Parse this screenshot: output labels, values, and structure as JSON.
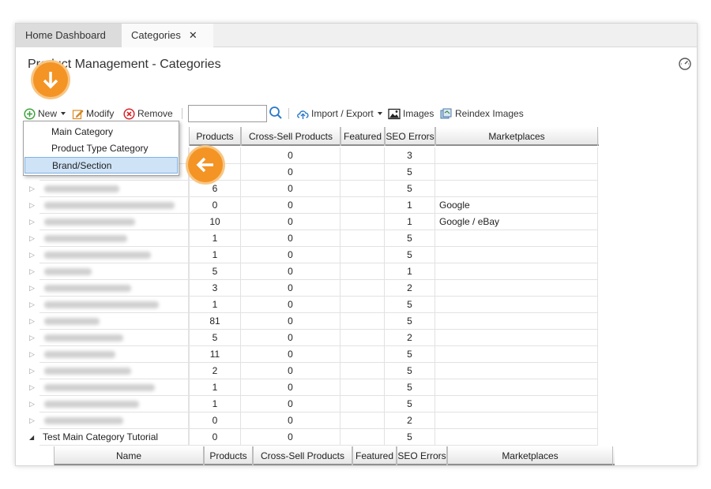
{
  "tabs": {
    "home": "Home Dashboard",
    "categories": "Categories",
    "close_glyph": "✕"
  },
  "page": {
    "title": "Product Management - Categories"
  },
  "toolbar": {
    "new_label": "New",
    "modify_label": "Modify",
    "remove_label": "Remove",
    "search_value": "",
    "import_export_label": "Import / Export",
    "images_label": "Images",
    "reindex_label": "Reindex Images"
  },
  "new_menu": {
    "items": [
      "Main Category",
      "Product Type Category",
      "Brand/Section"
    ],
    "selected": "Brand/Section"
  },
  "grid": {
    "columns": {
      "products": "Products",
      "cross_sell": "Cross-Sell Products",
      "featured": "Featured",
      "seo_errors": "SEO Errors",
      "marketplaces": "Marketplaces"
    },
    "rows": [
      {
        "products": "",
        "cross_sell": "0",
        "featured": "",
        "seo": "3",
        "marketplaces": ""
      },
      {
        "products": "",
        "cross_sell": "0",
        "featured": "",
        "seo": "5",
        "marketplaces": ""
      },
      {
        "products": "6",
        "cross_sell": "0",
        "featured": "",
        "seo": "5",
        "marketplaces": ""
      },
      {
        "products": "0",
        "cross_sell": "0",
        "featured": "",
        "seo": "1",
        "marketplaces": "Google"
      },
      {
        "products": "10",
        "cross_sell": "0",
        "featured": "",
        "seo": "1",
        "marketplaces": "Google / eBay"
      },
      {
        "products": "1",
        "cross_sell": "0",
        "featured": "",
        "seo": "5",
        "marketplaces": ""
      },
      {
        "products": "1",
        "cross_sell": "0",
        "featured": "",
        "seo": "5",
        "marketplaces": ""
      },
      {
        "products": "5",
        "cross_sell": "0",
        "featured": "",
        "seo": "1",
        "marketplaces": ""
      },
      {
        "products": "3",
        "cross_sell": "0",
        "featured": "",
        "seo": "2",
        "marketplaces": ""
      },
      {
        "products": "1",
        "cross_sell": "0",
        "featured": "",
        "seo": "5",
        "marketplaces": ""
      },
      {
        "products": "81",
        "cross_sell": "0",
        "featured": "",
        "seo": "5",
        "marketplaces": ""
      },
      {
        "products": "5",
        "cross_sell": "0",
        "featured": "",
        "seo": "2",
        "marketplaces": ""
      },
      {
        "products": "11",
        "cross_sell": "0",
        "featured": "",
        "seo": "5",
        "marketplaces": ""
      },
      {
        "products": "2",
        "cross_sell": "0",
        "featured": "",
        "seo": "5",
        "marketplaces": ""
      },
      {
        "products": "1",
        "cross_sell": "0",
        "featured": "",
        "seo": "5",
        "marketplaces": ""
      },
      {
        "products": "1",
        "cross_sell": "0",
        "featured": "",
        "seo": "5",
        "marketplaces": ""
      },
      {
        "products": "0",
        "cross_sell": "0",
        "featured": "",
        "seo": "2",
        "marketplaces": ""
      },
      {
        "name": "Test Main Category Tutorial",
        "products": "0",
        "cross_sell": "0",
        "featured": "",
        "seo": "5",
        "marketplaces": ""
      }
    ]
  },
  "child_grid": {
    "columns": {
      "name": "Name",
      "products": "Products",
      "cross_sell": "Cross-Sell Products",
      "featured": "Featured",
      "seo_errors": "SEO Errors",
      "marketplaces": "Marketplaces"
    }
  },
  "colors": {
    "accent_orange": "#f39425",
    "selection": "#cfe3f7",
    "new_icon_green": "#3ea33e",
    "remove_icon_red": "#d9262b",
    "link_blue": "#2a7ac9"
  },
  "icons": [
    "add-icon",
    "dropdown-arrow-icon",
    "edit-icon",
    "remove-icon",
    "search-icon",
    "cloud-upload-icon",
    "image-icon",
    "reindex-icon",
    "gauge-icon",
    "arrow-down-icon",
    "arrow-left-icon",
    "expand-icon",
    "collapse-icon"
  ]
}
